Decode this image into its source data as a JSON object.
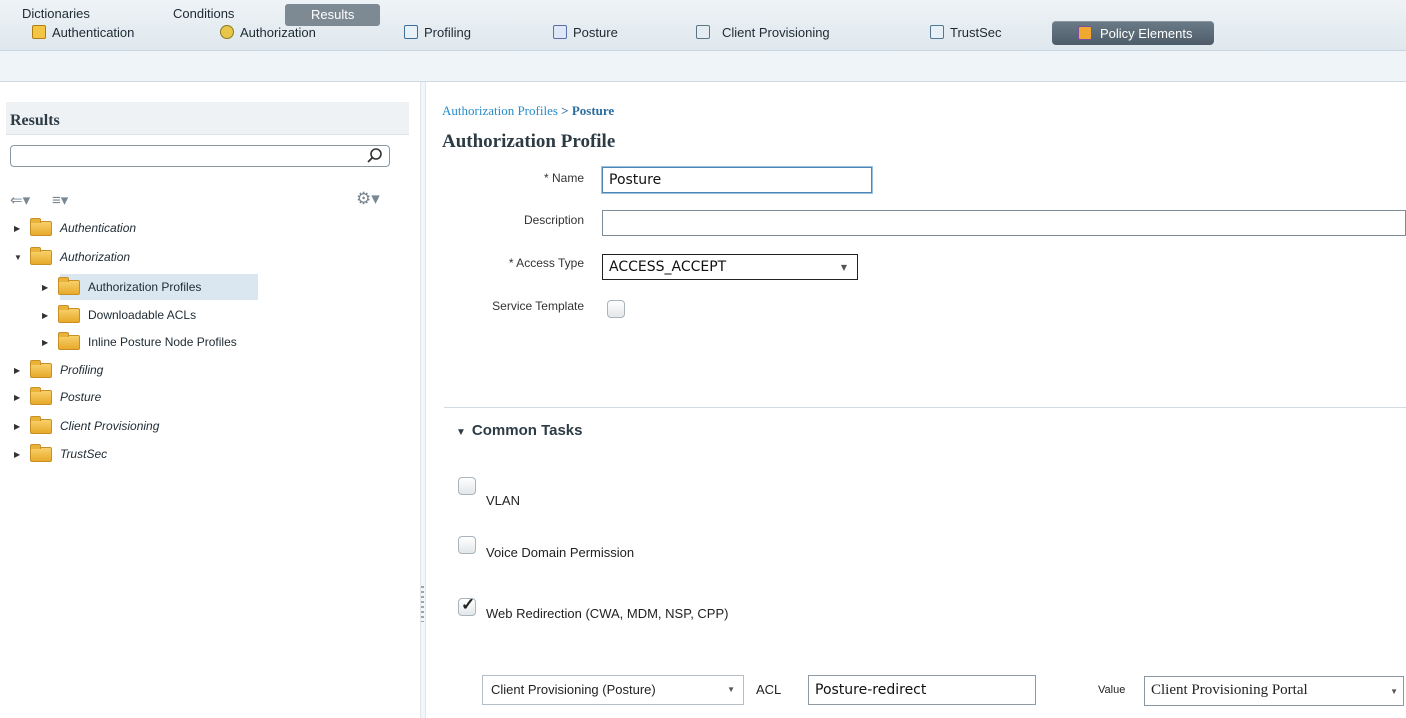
{
  "top_tabs": [
    {
      "label": "Authentication",
      "icon": "authentication-icon"
    },
    {
      "label": "Authorization",
      "icon": "authorization-icon"
    },
    {
      "label": "Profiling",
      "icon": "profiling-icon"
    },
    {
      "label": "Posture",
      "icon": "posture-icon"
    },
    {
      "label": "Client Provisioning",
      "icon": "client-provisioning-icon"
    },
    {
      "label": "TrustSec",
      "icon": "trustsec-icon"
    },
    {
      "label": "Policy Elements",
      "icon": "policy-elements-icon",
      "active": true
    }
  ],
  "sub_tabs": [
    {
      "label": "Dictionaries"
    },
    {
      "label": "Conditions"
    },
    {
      "label": "Results",
      "active": true
    }
  ],
  "sidebar": {
    "title": "Results",
    "search_value": "",
    "tree": [
      {
        "label": "Authentication",
        "expanded": false
      },
      {
        "label": "Authorization",
        "expanded": true
      },
      {
        "label": "Authorization Profiles",
        "expanded": false,
        "selected": true
      },
      {
        "label": "Downloadable ACLs",
        "expanded": false
      },
      {
        "label": "Inline Posture Node Profiles",
        "expanded": false
      },
      {
        "label": "Profiling",
        "expanded": false
      },
      {
        "label": "Posture",
        "expanded": false
      },
      {
        "label": "Client Provisioning",
        "expanded": false
      },
      {
        "label": "TrustSec",
        "expanded": false
      }
    ]
  },
  "main": {
    "breadcrumb_parent": "Authorization Profiles",
    "breadcrumb_sep": " > ",
    "breadcrumb_current": "Posture",
    "title": "Authorization Profile",
    "fields": {
      "name_label": "* Name",
      "name_value": "Posture",
      "description_label": "Description",
      "description_value": "",
      "access_type_label": "* Access Type",
      "access_type_value": "ACCESS_ACCEPT",
      "service_template_label": "Service Template",
      "service_template_checked": false
    },
    "common_tasks": {
      "title": "Common Tasks",
      "options": [
        {
          "label": "VLAN",
          "checked": false
        },
        {
          "label": "Voice Domain Permission",
          "checked": false
        },
        {
          "label": "Web Redirection (CWA, MDM, NSP, CPP)",
          "checked": true
        }
      ],
      "redirect_type": "Client Provisioning (Posture)",
      "acl_label": "ACL",
      "acl_value": "Posture-redirect",
      "value_label": "Value",
      "value_value": "Client Provisioning Portal"
    }
  }
}
